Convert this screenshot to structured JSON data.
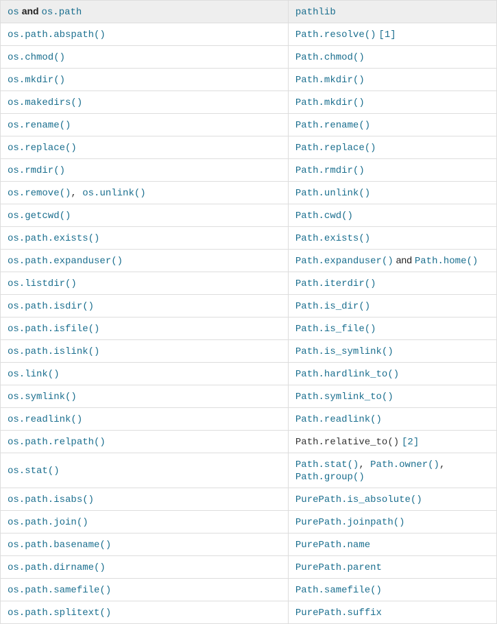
{
  "header": {
    "col1_a": "os",
    "col1_sep": "and",
    "col1_b": "os.path",
    "col2": "pathlib"
  },
  "rows": [
    {
      "left": [
        {
          "t": "link",
          "v": "os.path.abspath()"
        }
      ],
      "right": [
        {
          "t": "link",
          "v": "Path.resolve()"
        },
        {
          "t": "space"
        },
        {
          "t": "link",
          "v": "[1]"
        }
      ]
    },
    {
      "left": [
        {
          "t": "link",
          "v": "os.chmod()"
        }
      ],
      "right": [
        {
          "t": "link",
          "v": "Path.chmod()"
        }
      ]
    },
    {
      "left": [
        {
          "t": "link",
          "v": "os.mkdir()"
        }
      ],
      "right": [
        {
          "t": "link",
          "v": "Path.mkdir()"
        }
      ]
    },
    {
      "left": [
        {
          "t": "link",
          "v": "os.makedirs()"
        }
      ],
      "right": [
        {
          "t": "link",
          "v": "Path.mkdir()"
        }
      ]
    },
    {
      "left": [
        {
          "t": "link",
          "v": "os.rename()"
        }
      ],
      "right": [
        {
          "t": "link",
          "v": "Path.rename()"
        }
      ]
    },
    {
      "left": [
        {
          "t": "link",
          "v": "os.replace()"
        }
      ],
      "right": [
        {
          "t": "link",
          "v": "Path.replace()"
        }
      ]
    },
    {
      "left": [
        {
          "t": "link",
          "v": "os.rmdir()"
        }
      ],
      "right": [
        {
          "t": "link",
          "v": "Path.rmdir()"
        }
      ]
    },
    {
      "left": [
        {
          "t": "link",
          "v": "os.remove()"
        },
        {
          "t": "text",
          "v": ", "
        },
        {
          "t": "link",
          "v": "os.unlink()"
        }
      ],
      "right": [
        {
          "t": "link",
          "v": "Path.unlink()"
        }
      ]
    },
    {
      "left": [
        {
          "t": "link",
          "v": "os.getcwd()"
        }
      ],
      "right": [
        {
          "t": "link",
          "v": "Path.cwd()"
        }
      ]
    },
    {
      "left": [
        {
          "t": "link",
          "v": "os.path.exists()"
        }
      ],
      "right": [
        {
          "t": "link",
          "v": "Path.exists()"
        }
      ]
    },
    {
      "left": [
        {
          "t": "link",
          "v": "os.path.expanduser()"
        }
      ],
      "right": [
        {
          "t": "link",
          "v": "Path.expanduser()"
        },
        {
          "t": "and",
          "v": " and "
        },
        {
          "t": "link",
          "v": "Path.home()"
        }
      ]
    },
    {
      "left": [
        {
          "t": "link",
          "v": "os.listdir()"
        }
      ],
      "right": [
        {
          "t": "link",
          "v": "Path.iterdir()"
        }
      ]
    },
    {
      "left": [
        {
          "t": "link",
          "v": "os.path.isdir()"
        }
      ],
      "right": [
        {
          "t": "link",
          "v": "Path.is_dir()"
        }
      ]
    },
    {
      "left": [
        {
          "t": "link",
          "v": "os.path.isfile()"
        }
      ],
      "right": [
        {
          "t": "link",
          "v": "Path.is_file()"
        }
      ]
    },
    {
      "left": [
        {
          "t": "link",
          "v": "os.path.islink()"
        }
      ],
      "right": [
        {
          "t": "link",
          "v": "Path.is_symlink()"
        }
      ]
    },
    {
      "left": [
        {
          "t": "link",
          "v": "os.link()"
        }
      ],
      "right": [
        {
          "t": "link",
          "v": "Path.hardlink_to()"
        }
      ]
    },
    {
      "left": [
        {
          "t": "link",
          "v": "os.symlink()"
        }
      ],
      "right": [
        {
          "t": "link",
          "v": "Path.symlink_to()"
        }
      ]
    },
    {
      "left": [
        {
          "t": "link",
          "v": "os.readlink()"
        }
      ],
      "right": [
        {
          "t": "link",
          "v": "Path.readlink()"
        }
      ]
    },
    {
      "left": [
        {
          "t": "link",
          "v": "os.path.relpath()"
        }
      ],
      "right": [
        {
          "t": "plain",
          "v": "Path.relative_to()"
        },
        {
          "t": "space"
        },
        {
          "t": "link",
          "v": "[2]"
        }
      ]
    },
    {
      "left": [
        {
          "t": "link",
          "v": "os.stat()"
        }
      ],
      "right": [
        {
          "t": "link",
          "v": "Path.stat()"
        },
        {
          "t": "text",
          "v": ", "
        },
        {
          "t": "link",
          "v": "Path.owner()"
        },
        {
          "t": "text",
          "v": ", "
        },
        {
          "t": "link",
          "v": "Path.group()"
        }
      ]
    },
    {
      "left": [
        {
          "t": "link",
          "v": "os.path.isabs()"
        }
      ],
      "right": [
        {
          "t": "link",
          "v": "PurePath.is_absolute()"
        }
      ]
    },
    {
      "left": [
        {
          "t": "link",
          "v": "os.path.join()"
        }
      ],
      "right": [
        {
          "t": "link",
          "v": "PurePath.joinpath()"
        }
      ]
    },
    {
      "left": [
        {
          "t": "link",
          "v": "os.path.basename()"
        }
      ],
      "right": [
        {
          "t": "link",
          "v": "PurePath.name"
        }
      ]
    },
    {
      "left": [
        {
          "t": "link",
          "v": "os.path.dirname()"
        }
      ],
      "right": [
        {
          "t": "link",
          "v": "PurePath.parent"
        }
      ]
    },
    {
      "left": [
        {
          "t": "link",
          "v": "os.path.samefile()"
        }
      ],
      "right": [
        {
          "t": "link",
          "v": "Path.samefile()"
        }
      ]
    },
    {
      "left": [
        {
          "t": "link",
          "v": "os.path.splitext()"
        }
      ],
      "right": [
        {
          "t": "link",
          "v": "PurePath.suffix"
        }
      ]
    }
  ]
}
